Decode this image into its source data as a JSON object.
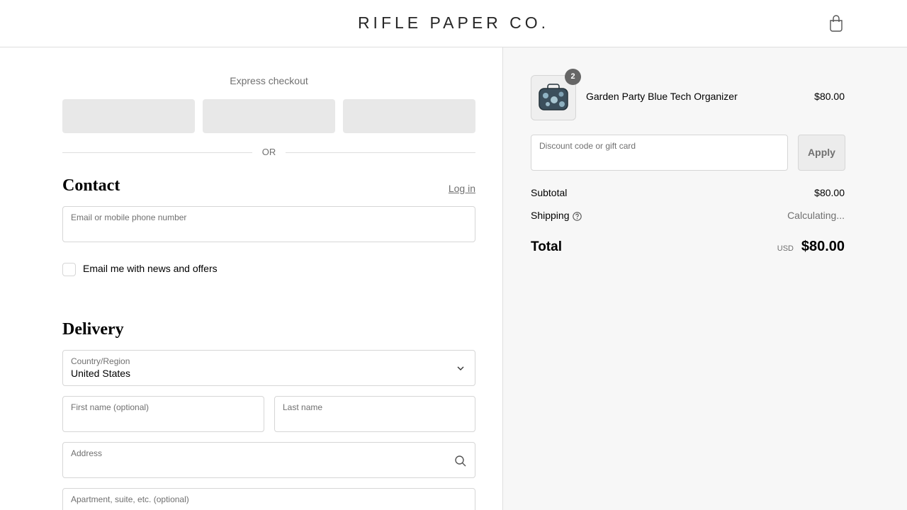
{
  "header": {
    "brand": "RIFLE PAPER CO.",
    "cart_icon": "shopping-bag-icon"
  },
  "express": {
    "title": "Express checkout",
    "or_text": "OR"
  },
  "contact": {
    "title": "Contact",
    "login_label": "Log in",
    "email_label": "Email or mobile phone number",
    "email_value": "",
    "newsletter_label": "Email me with news and offers",
    "newsletter_checked": false
  },
  "delivery": {
    "title": "Delivery",
    "country_label": "Country/Region",
    "country_value": "United States",
    "first_name_label": "First name (optional)",
    "last_name_label": "Last name",
    "address_label": "Address",
    "apartment_label": "Apartment, suite, etc. (optional)"
  },
  "order_summary": {
    "product": {
      "name": "Garden Party Blue Tech Organizer",
      "price": "$80.00",
      "quantity": "2"
    },
    "discount_label": "Discount code or gift card",
    "apply_label": "Apply",
    "subtotal_label": "Subtotal",
    "subtotal_value": "$80.00",
    "shipping_label": "Shipping",
    "shipping_value": "Calculating...",
    "total_label": "Total",
    "total_currency": "USD",
    "total_value": "$80.00"
  },
  "colors": {
    "sidebar_bg": "#f7f7f7",
    "border": "#d6d6d6",
    "muted_text": "#707070",
    "express_button": "#e8e8e8",
    "badge": "#666666"
  }
}
